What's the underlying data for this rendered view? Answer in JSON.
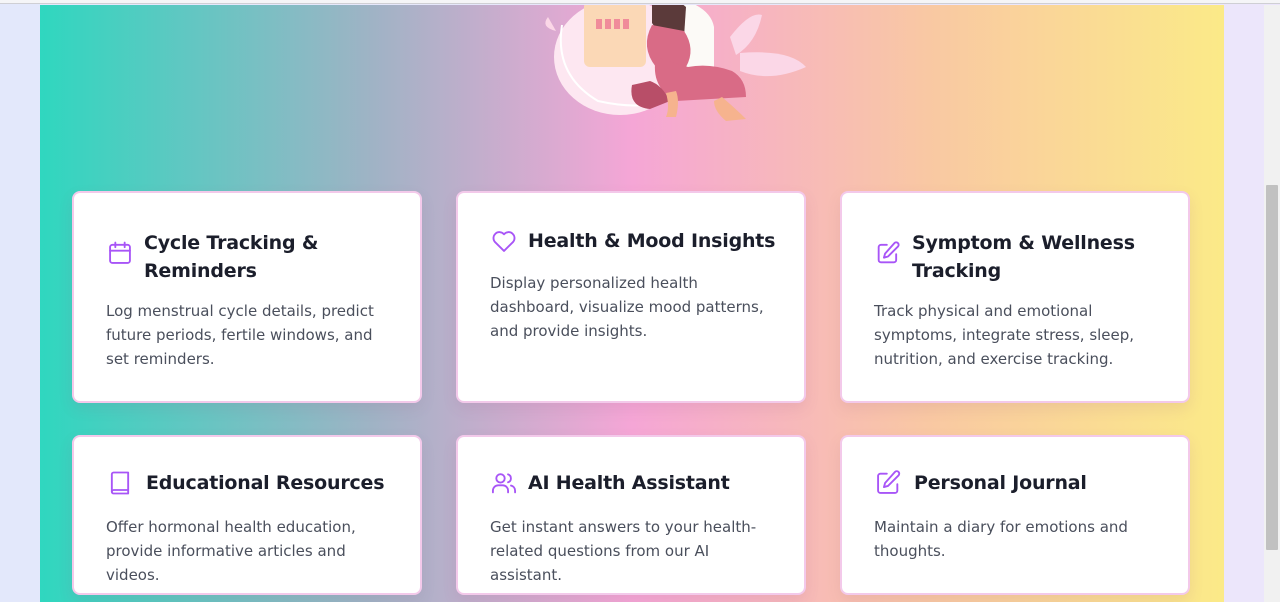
{
  "colors": {
    "icon_purple": "#a855f7",
    "card_border": "#f3c9ea",
    "title_color": "#1b1e2b",
    "text_color": "#4a4f5c"
  },
  "features": [
    {
      "icon": "calendar-icon",
      "title": "Cycle Tracking & Reminders",
      "description": "Log menstrual cycle details, predict future periods, fertile windows, and set reminders."
    },
    {
      "icon": "heart-icon",
      "title": "Health & Mood Insights",
      "description": "Display personalized health dashboard, visualize mood patterns, and provide insights."
    },
    {
      "icon": "edit-icon",
      "title": "Symptom & Wellness Tracking",
      "description": "Track physical and emotional symptoms, integrate stress, sleep, nutrition, and exercise tracking."
    },
    {
      "icon": "book-icon",
      "title": "Educational Resources",
      "description": "Offer hormonal health education, provide informative articles and videos."
    },
    {
      "icon": "users-icon",
      "title": "AI Health Assistant",
      "description": "Get instant answers to your health-related questions from our AI assistant."
    },
    {
      "icon": "journal-edit-icon",
      "title": "Personal Journal",
      "description": "Maintain a diary for emotions and thoughts."
    }
  ]
}
